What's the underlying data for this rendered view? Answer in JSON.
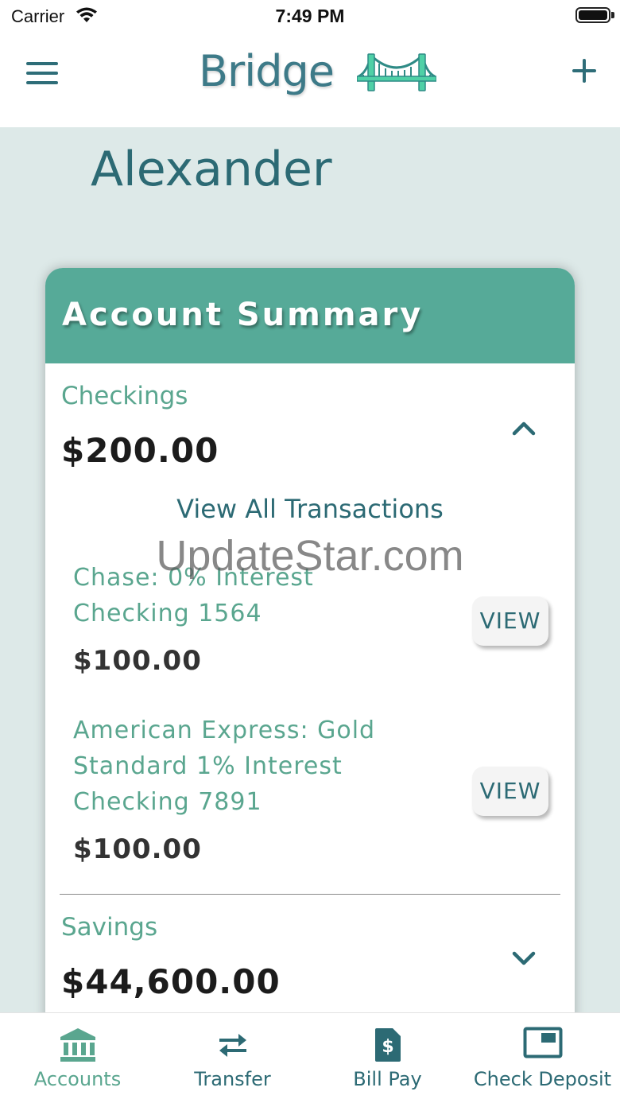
{
  "status_bar": {
    "carrier": "Carrier",
    "time": "7:49 PM"
  },
  "nav": {
    "brand": "Bridge",
    "icons": [
      "menu-icon",
      "bridge-logo",
      "plus-icon"
    ]
  },
  "greeting": "Alexander",
  "card": {
    "title": "Account Summary",
    "checkings": {
      "label": "Checkings",
      "balance": "$200.00",
      "expanded": true,
      "view_all": "View All Transactions",
      "accounts": [
        {
          "name": "Chase: 0% Interest Checking 1564",
          "balance": "$100.00",
          "button": "VIEW"
        },
        {
          "name": "American Express: Gold Standard 1% Interest Checking 7891",
          "balance": "$100.00",
          "button": "VIEW"
        }
      ]
    },
    "savings": {
      "label": "Savings",
      "balance": "$44,600.00",
      "expanded": false
    }
  },
  "watermark": "UpdateStar.com",
  "tabs": [
    {
      "label": "Accounts",
      "icon": "bank-icon",
      "active": true
    },
    {
      "label": "Transfer",
      "icon": "transfer-arrows-icon",
      "active": false
    },
    {
      "label": "Bill Pay",
      "icon": "bill-icon",
      "active": false
    },
    {
      "label": "Check Deposit",
      "icon": "check-deposit-icon",
      "active": false
    }
  ],
  "colors": {
    "primary": "#2c6a74",
    "accent": "#56aa98",
    "accent_text": "#5aa68f",
    "background": "#dde9e8",
    "tab_active": "#5aa68f",
    "tab_inactive": "#2c6a74"
  }
}
